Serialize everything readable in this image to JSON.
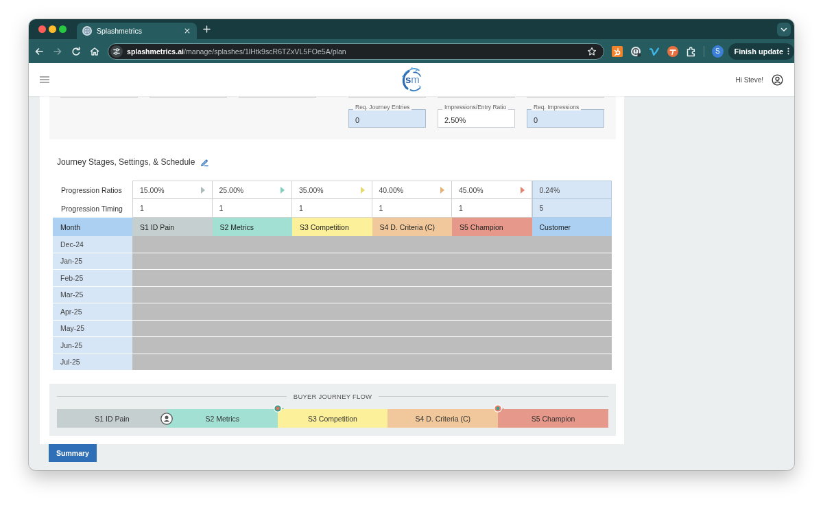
{
  "browser": {
    "tabs": [
      {
        "title": "Splashmetrics",
        "selected": true
      }
    ],
    "nav_buttons": [
      {
        "kind": "back",
        "disabled": false
      },
      {
        "kind": "forward",
        "disabled": true
      },
      {
        "kind": "reload",
        "disabled": false
      },
      {
        "kind": "home",
        "disabled": false
      }
    ],
    "address": {
      "domain": "splashmetrics.ai",
      "path": "/manage/splashes/1lHtk9scR6TZxVL5FOe5A/plan"
    },
    "profile": {
      "initial": "S"
    },
    "update_button": {
      "label": "Finish update"
    }
  },
  "app_header": {
    "logo": "**s**m",
    "greeting": "Hi Steve!"
  },
  "metrics": {
    "fields": [
      {
        "label": "Req. Journey Entries",
        "value": "0",
        "highlighted": true
      },
      {
        "label": "Impressions/Entry Ratio",
        "value": "2.50%",
        "highlighted": false
      },
      {
        "label": "Req. Impressions",
        "value": "0",
        "highlighted": true
      }
    ]
  },
  "schedule": {
    "title": "Journey Stages, Settings, & Schedule",
    "ratio_label": "Progression Ratios",
    "timing_label": "Progression Timing",
    "month_header": "Month",
    "stages": [
      {
        "kind": "stage",
        "name": "S1 ID Pain",
        "ratio": "15.00%",
        "timing": "1",
        "color": "#c5cfcf"
      },
      {
        "kind": "stage",
        "name": "S2 Metrics",
        "ratio": "25.00%",
        "timing": "1",
        "color": "#a3e0d4"
      },
      {
        "kind": "stage",
        "name": "S3 Competition",
        "ratio": "35.00%",
        "timing": "1",
        "color": "#fcf09b"
      },
      {
        "kind": "stage",
        "name": "S4 D. Criteria (C)",
        "ratio": "40.00%",
        "timing": "1",
        "color": "#f0c89b"
      },
      {
        "kind": "stage",
        "name": "S5 Champion",
        "ratio": "45.00%",
        "timing": "1",
        "color": "#e6988a"
      },
      {
        "kind": "customer",
        "name": "Customer",
        "ratio": "0.24%",
        "timing": "5",
        "color": "#acd0f2"
      }
    ],
    "months": [
      "Dec-24",
      "Jan-25",
      "Feb-25",
      "Mar-25",
      "Apr-25",
      "May-25",
      "Jun-25",
      "Jul-25"
    ]
  },
  "flow": {
    "title": "BUYER JOURNEY FLOW",
    "stages": [
      {
        "label": "S1 ID Pain",
        "color": "#c5cfcf",
        "person_marker": true
      },
      {
        "label": "S2 Metrics",
        "color": "#a3e0d4",
        "person_marker": false,
        "pin": {
          "ring": {
            "color": "#3f9d8e"
          },
          "dot": {
            "color": "#e8735d"
          }
        }
      },
      {
        "label": "S3 Competition",
        "color": "#fcf09b",
        "person_marker": false
      },
      {
        "label": "S4 D. Criteria (C)",
        "color": "#f0c89b",
        "person_marker": false,
        "pin": {
          "ring": {
            "color": "#e5806c"
          },
          "dot": {
            "color": "#3f9d8e"
          }
        }
      },
      {
        "label": "S5 Champion",
        "color": "#e6988a",
        "person_marker": false
      }
    ]
  },
  "summary_button": {
    "label": "Summary"
  }
}
